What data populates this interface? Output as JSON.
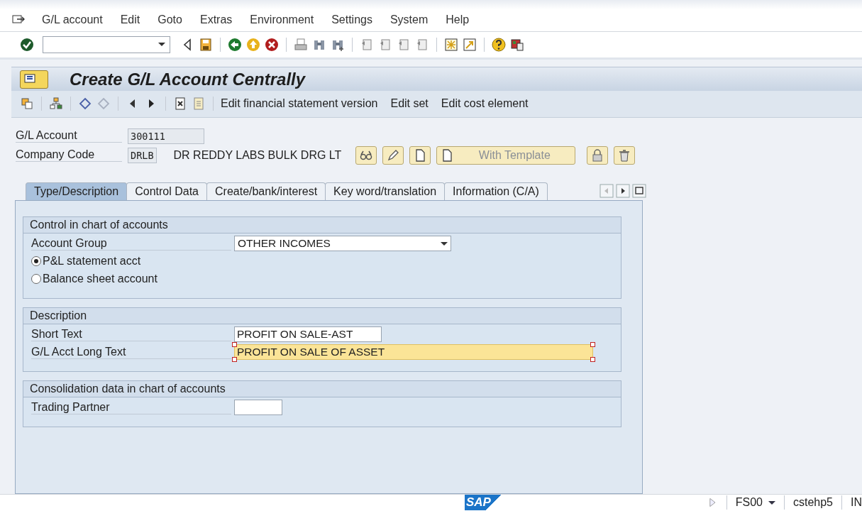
{
  "menu": [
    {
      "label": "G/L account"
    },
    {
      "label": "Edit"
    },
    {
      "label": "Goto"
    },
    {
      "label": "Extras"
    },
    {
      "label": "Environment"
    },
    {
      "label": "Settings"
    },
    {
      "label": "System"
    },
    {
      "label": "Help"
    }
  ],
  "title": "Create G/L Account Centrally",
  "app_toolbar": [
    "Edit financial statement version",
    "Edit set",
    "Edit cost element"
  ],
  "header_fields": [
    {
      "label": "G/L Account",
      "value": "300111"
    },
    {
      "label": "Company Code",
      "value": "DRLB",
      "description": "DR REDDY LABS BULK DRG LT"
    }
  ],
  "template_button": "With Template",
  "tabs": [
    {
      "label": "Type/Description",
      "selected": true
    },
    {
      "label": "Control Data",
      "selected": false
    },
    {
      "label": "Create/bank/interest",
      "selected": false
    },
    {
      "label": "Key word/translation",
      "selected": false
    },
    {
      "label": "Information (C/A)",
      "selected": false
    }
  ],
  "groups": [
    {
      "title": "Control in chart of accounts",
      "rows": [
        {
          "kind": "dropdown",
          "label": "Account Group",
          "value": "OTHER INCOMES"
        },
        {
          "kind": "radio",
          "label": "P&L statement acct",
          "selected": true
        },
        {
          "kind": "radio",
          "label": "Balance sheet account",
          "selected": false
        }
      ]
    },
    {
      "title": "Description",
      "rows": [
        {
          "kind": "text",
          "label": "Short Text",
          "value": "PROFIT ON SALE-AST",
          "focused": false
        },
        {
          "kind": "long_text",
          "label": "G/L Acct Long Text",
          "value": "PROFIT ON SALE OF ASSET",
          "focused": true
        }
      ]
    },
    {
      "title": "Consolidation data in chart of accounts",
      "rows": [
        {
          "kind": "code",
          "label": "Trading Partner",
          "focused": false
        }
      ]
    }
  ],
  "status_bar": {
    "logo": "SAP",
    "transaction": "FS00",
    "server": "cstehp5",
    "mode": "IN"
  }
}
